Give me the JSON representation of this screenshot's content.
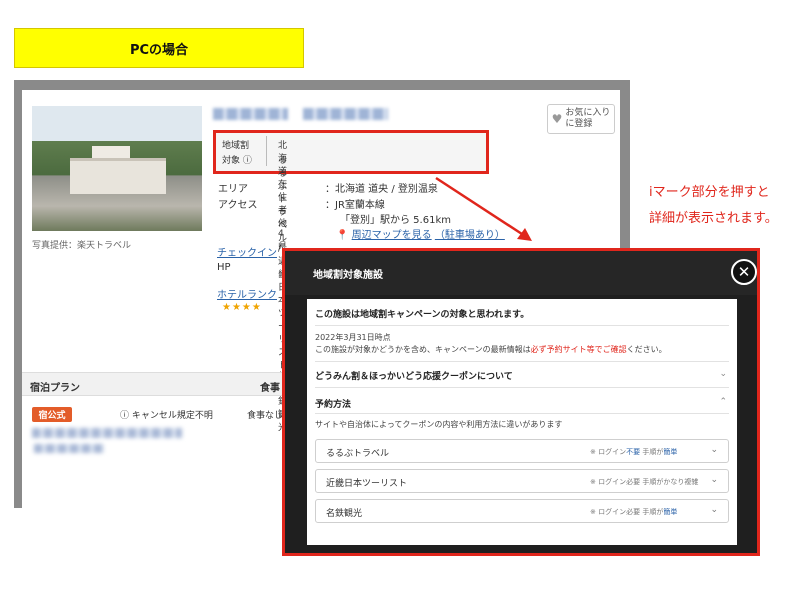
{
  "header": {
    "pc_label": "PCの場合"
  },
  "listing": {
    "photo_credit": "写真提供：楽天トラベル",
    "favorite": {
      "line1": "お気に入り",
      "line2": "に登録"
    },
    "region_box": {
      "label1": "地域割",
      "label2": "対象 ⓘ",
      "value1": "北海道在住者 他4県",
      "value2": "るるぶトラベル / 近畿日本ツーリスト / 名鉄観光"
    },
    "area_label": "エリア",
    "area_value": "：北海道 道央 / 登別温泉",
    "access_label": "アクセス",
    "access_value1": "：JR室蘭本線",
    "access_value2": "「登別」駅から 5.61km",
    "map_link": "周辺マップを見る",
    "parking": "（駐車場あり）",
    "checkin_label": "チェックイン",
    "hp_label": "HP",
    "rank_label": "ホテルランク",
    "stars": "★★★★",
    "plan_header": "宿泊プラン",
    "meal_header": "食事",
    "badge": "宿公式",
    "cancel_text": "ⓘ キャンセル規定不明",
    "meal_value": "食事なし"
  },
  "annotation": {
    "line1": "iマーク部分を押すと",
    "line2": "詳細が表示されます。"
  },
  "modal": {
    "title": "地域割対象施設",
    "close": "✕",
    "notice": "この施設は地域割キャンペーンの対象と思われます。",
    "date": "2022年3月31日時点",
    "info_pre": "この施設が対象かどうかを含め、キャンペーンの最新情報は",
    "info_red": "必ず予約サイト等でご確認",
    "info_post": "ください。",
    "section1": "どうみん割＆ほっかいどう応援クーポンについて",
    "section1_chev": "⌄",
    "section2": "予約方法",
    "section2_chev": "⌃",
    "section2_desc": "サイトや自治体によってクーポンの内容や利用方法に違いがあります",
    "options": [
      {
        "name": "るるぶトラベル",
        "note_pre": "※ ログイン",
        "note_blue1": "不要",
        "note_mid": " 手順が",
        "note_blue2": "簡単",
        "chev": "⌄"
      },
      {
        "name": "近畿日本ツーリスト",
        "note_pre": "※ ログイン必要 手順がかなり",
        "note_blue1": "",
        "note_mid": "複雑",
        "note_blue2": "",
        "chev": "⌄"
      },
      {
        "name": "名鉄観光",
        "note_pre": "※ ログイン必要 手順が",
        "note_blue1": "",
        "note_mid": "",
        "note_blue2": "簡単",
        "chev": "⌄"
      }
    ]
  },
  "colors": {
    "highlight": "#ffff00",
    "annotation_red": "#e0261c",
    "badge_orange": "#e35c29",
    "link_blue": "#2a62a8"
  }
}
